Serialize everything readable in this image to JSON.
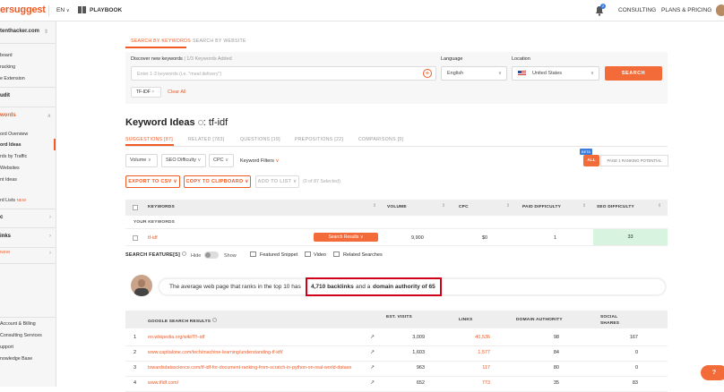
{
  "topbar": {
    "logo": "ersuggest",
    "lang": "EN",
    "playbook": "PLAYBOOK",
    "notif_count": "2",
    "consulting": "CONSULTING",
    "plans": "PLANS & PRICING"
  },
  "sidebar": {
    "site": "tenthacker.com",
    "items": [
      "board",
      "racking",
      "e Extension"
    ],
    "audit": "udit",
    "keywords": "words",
    "kw_items": [
      "ord Overview",
      "ord Ideas",
      "rds by Traffic",
      "Websites",
      "nt Ideas"
    ],
    "lists": "rd Lists",
    "new1": "NEW",
    "c": "c",
    "links": "inks",
    "new2": "NEW",
    "bottom": [
      "Account & Billing",
      "Consulting Services",
      "upport",
      "nowledge Base"
    ]
  },
  "search": {
    "tabs": [
      "SEARCH BY KEYWORDS",
      "SEARCH BY WEBSITE"
    ],
    "discover_label": "Discover new keywords",
    "added": "1/3 Keywords Added",
    "placeholder": "Enter 1-3 keywords (i.e. \"meal delivery\")",
    "language_label": "Language",
    "language_value": "English",
    "location_label": "Location",
    "location_value": "United States",
    "search_btn": "SEARCH",
    "chip": "TF-IDF",
    "clear": "Clear All"
  },
  "ideas": {
    "title": "Keyword Ideas",
    "term": "tf-idf",
    "tabs": [
      "SUGGESTIONS [87]",
      "RELATED [783]",
      "QUESTIONS [19]",
      "PREPOSITIONS [22]",
      "COMPARISONS [9]"
    ],
    "filters": [
      "Volume",
      "SEO Difficulty",
      "CPC",
      "Keyword Filters"
    ],
    "beta": "BETA",
    "all": "ALL",
    "page1": "PAGE 1 RANKING POTENTIAL",
    "export": "EXPORT TO CSV",
    "copy": "COPY TO CLIPBOARD",
    "addlist": "ADD TO LIST",
    "selected": "0 of 87 Selected"
  },
  "kw_table": {
    "headers": [
      "KEYWORDS",
      "VOLUME",
      "CPC",
      "PAID DIFFICULTY",
      "SEO DIFFICULTY"
    ],
    "your_keywords": "YOUR KEYWORDS",
    "row": {
      "keyword": "tf-idf",
      "results": "Search Results",
      "volume": "9,900",
      "cpc": "$0",
      "paid": "1",
      "seo": "33"
    }
  },
  "features": {
    "label": "SEARCH FEATURE[S]",
    "hide": "Hide",
    "show": "Show",
    "items": [
      "Featured Snippet",
      "Video",
      "Related Searches"
    ]
  },
  "insight": {
    "pre": "The average web page that ranks in the top 10 has",
    "backlinks": "4,710 backlinks",
    "mid": "and a",
    "authority": "domain authority of 65"
  },
  "serp": {
    "headers": [
      "GOOGLE SEARCH RESULTS",
      "EST. VISITS",
      "LINKS",
      "DOMAIN AUTHORITY",
      "SOCIAL SHARES"
    ],
    "rows": [
      {
        "n": "1",
        "url": "en.wikipedia.org/wiki/Tf–idf",
        "visits": "3,009",
        "links": "40,536",
        "da": "98",
        "shares": "167"
      },
      {
        "n": "2",
        "url": "www.capitalone.com/tech/machine-learning/understanding-tf-idf/",
        "visits": "1,603",
        "links": "1,577",
        "da": "84",
        "shares": "0"
      },
      {
        "n": "3",
        "url": "towardsdatascience.com/tf-idf-for-document-ranking-from-scratch-in-python-on-real-world-datase",
        "visits": "963",
        "links": "117",
        "da": "80",
        "shares": "0"
      },
      {
        "n": "4",
        "url": "www.tfidf.com/",
        "visits": "652",
        "links": "773",
        "da": "35",
        "shares": "83"
      }
    ]
  },
  "colors": {
    "accent": "#f15a24",
    "highlight_red": "#d0021b",
    "seo_green": "#d8f3e0"
  }
}
